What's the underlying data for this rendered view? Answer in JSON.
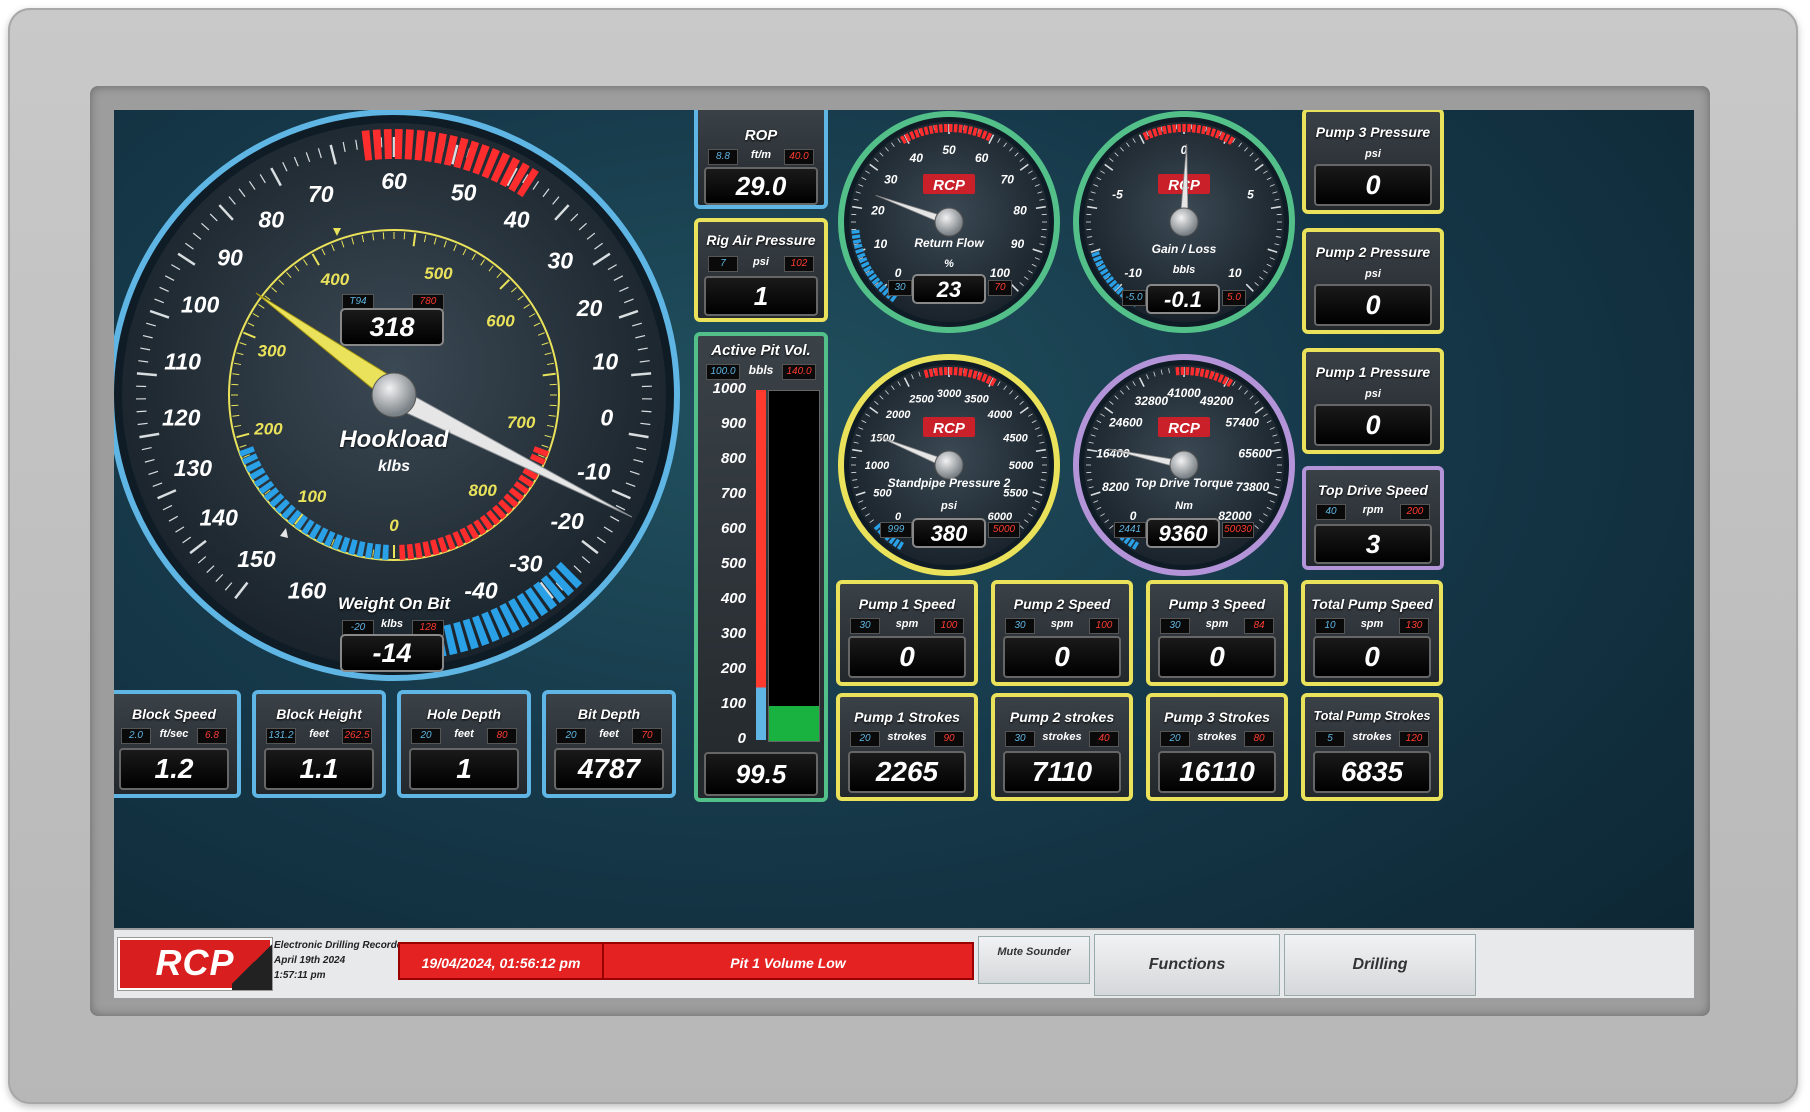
{
  "hookload": {
    "title": "Hookload",
    "units": "klbs",
    "value": "318",
    "lo": "T94",
    "hi": "780",
    "outer_ticks": [
      "60",
      "50",
      "40",
      "30",
      "20",
      "10",
      "0",
      "-10",
      "-20",
      "-30",
      "-40",
      "160",
      "150",
      "140",
      "130",
      "120",
      "110",
      "100",
      "90",
      "80",
      "70"
    ],
    "inner_ticks": [
      "0",
      "100",
      "200",
      "300",
      "400",
      "500",
      "600",
      "700",
      "800"
    ]
  },
  "wob": {
    "title": "Weight On Bit",
    "units": "klbs",
    "value": "-14",
    "lo": "-20",
    "hi": "128"
  },
  "rop": {
    "title": "ROP",
    "units": "ft/m",
    "lo": "8.8",
    "hi": "40.0",
    "value": "29.0"
  },
  "rig_air": {
    "title": "Rig Air Pressure",
    "units": "psi",
    "lo": "7",
    "hi": "102",
    "value": "1"
  },
  "pit": {
    "title": "Active Pit Vol.",
    "units": "bbls",
    "lo": "100.0",
    "hi": "140.0",
    "value": "99.5",
    "level_fraction": 0.1,
    "scale": [
      "1000",
      "900",
      "800",
      "700",
      "600",
      "500",
      "400",
      "300",
      "200",
      "100",
      "0"
    ]
  },
  "return_flow": {
    "title": "Return Flow",
    "units": "%",
    "value": "23",
    "lo": "30",
    "hi": "70",
    "logo": "RCP",
    "ticks": [
      "0",
      "10",
      "20",
      "30",
      "40",
      "50",
      "60",
      "70",
      "80",
      "90",
      "100"
    ]
  },
  "gain_loss": {
    "title": "Gain / Loss",
    "units": "bbls",
    "value": "-0.1",
    "lo": "-5.0",
    "hi": "5.0",
    "logo": "RCP",
    "ticks": [
      "-10",
      "-5",
      "0",
      "5",
      "10"
    ]
  },
  "standpipe": {
    "title": "Standpipe Pressure 2",
    "units": "psi",
    "value": "380",
    "lo": "999",
    "hi": "5000",
    "logo": "RCP",
    "ticks": [
      "0",
      "500",
      "1000",
      "1500",
      "2000",
      "2500",
      "3000",
      "3500",
      "4000",
      "4500",
      "5000",
      "5500",
      "6000"
    ]
  },
  "torque": {
    "title": "Top Drive Torque",
    "units": "Nm",
    "value": "9360",
    "lo": "2441",
    "hi": "50030",
    "logo": "RCP",
    "ticks": [
      "0",
      "8200",
      "16400",
      "24600",
      "32800",
      "41000",
      "49200",
      "57400",
      "65600",
      "73800",
      "82000"
    ]
  },
  "right_panels": [
    {
      "title": "Pump 3 Pressure",
      "units": "psi",
      "value": "0"
    },
    {
      "title": "Pump 2 Pressure",
      "units": "psi",
      "value": "0"
    },
    {
      "title": "Pump 1 Pressure",
      "units": "psi",
      "value": "0"
    }
  ],
  "top_drive_speed": {
    "title": "Top Drive Speed",
    "units": "rpm",
    "lo": "40",
    "hi": "200",
    "value": "3"
  },
  "bottom_left": [
    {
      "title": "Block Speed",
      "units": "ft/sec",
      "lo": "2.0",
      "hi": "6.8",
      "value": "1.2"
    },
    {
      "title": "Block Height",
      "units": "feet",
      "lo": "131.2",
      "hi": "262.5",
      "value": "1.1"
    },
    {
      "title": "Hole Depth",
      "units": "feet",
      "lo": "20",
      "hi": "80",
      "value": "1"
    },
    {
      "title": "Bit Depth",
      "units": "feet",
      "lo": "20",
      "hi": "70",
      "value": "4787"
    }
  ],
  "speed_panels": [
    {
      "title": "Pump 1 Speed",
      "units": "spm",
      "lo": "30",
      "hi": "100",
      "value": "0"
    },
    {
      "title": "Pump 2 Speed",
      "units": "spm",
      "lo": "30",
      "hi": "100",
      "value": "0"
    },
    {
      "title": "Pump 3 Speed",
      "units": "spm",
      "lo": "30",
      "hi": "84",
      "value": "0"
    },
    {
      "title": "Total Pump Speed",
      "units": "spm",
      "lo": "10",
      "hi": "130",
      "value": "0"
    }
  ],
  "stroke_panels": [
    {
      "title": "Pump 1 Strokes",
      "units": "strokes",
      "lo": "20",
      "hi": "90",
      "value": "2265"
    },
    {
      "title": "Pump 2 strokes",
      "units": "strokes",
      "lo": "30",
      "hi": "40",
      "value": "7110"
    },
    {
      "title": "Pump 3 Strokes",
      "units": "strokes",
      "lo": "20",
      "hi": "80",
      "value": "16110"
    },
    {
      "title": "Total Pump Strokes",
      "units": "strokes",
      "lo": "5",
      "hi": "120",
      "value": "6835"
    }
  ],
  "status": {
    "logo": "RCP",
    "app_name": "Electronic Drilling Recorder",
    "date": "April 19th 2024",
    "time": "1:57:11 pm",
    "alarm_time": "19/04/2024, 01:56:12 pm",
    "alarm_message": "Pit 1 Volume Low",
    "mute_label": "Mute Sounder",
    "functions_label": "Functions",
    "drilling_label": "Drilling"
  },
  "colors": {
    "blue": "#5fb6e4",
    "yellow": "#e9e25a",
    "green": "#53c08a",
    "purple": "#b494d8",
    "alarm_red": "#e52222"
  }
}
